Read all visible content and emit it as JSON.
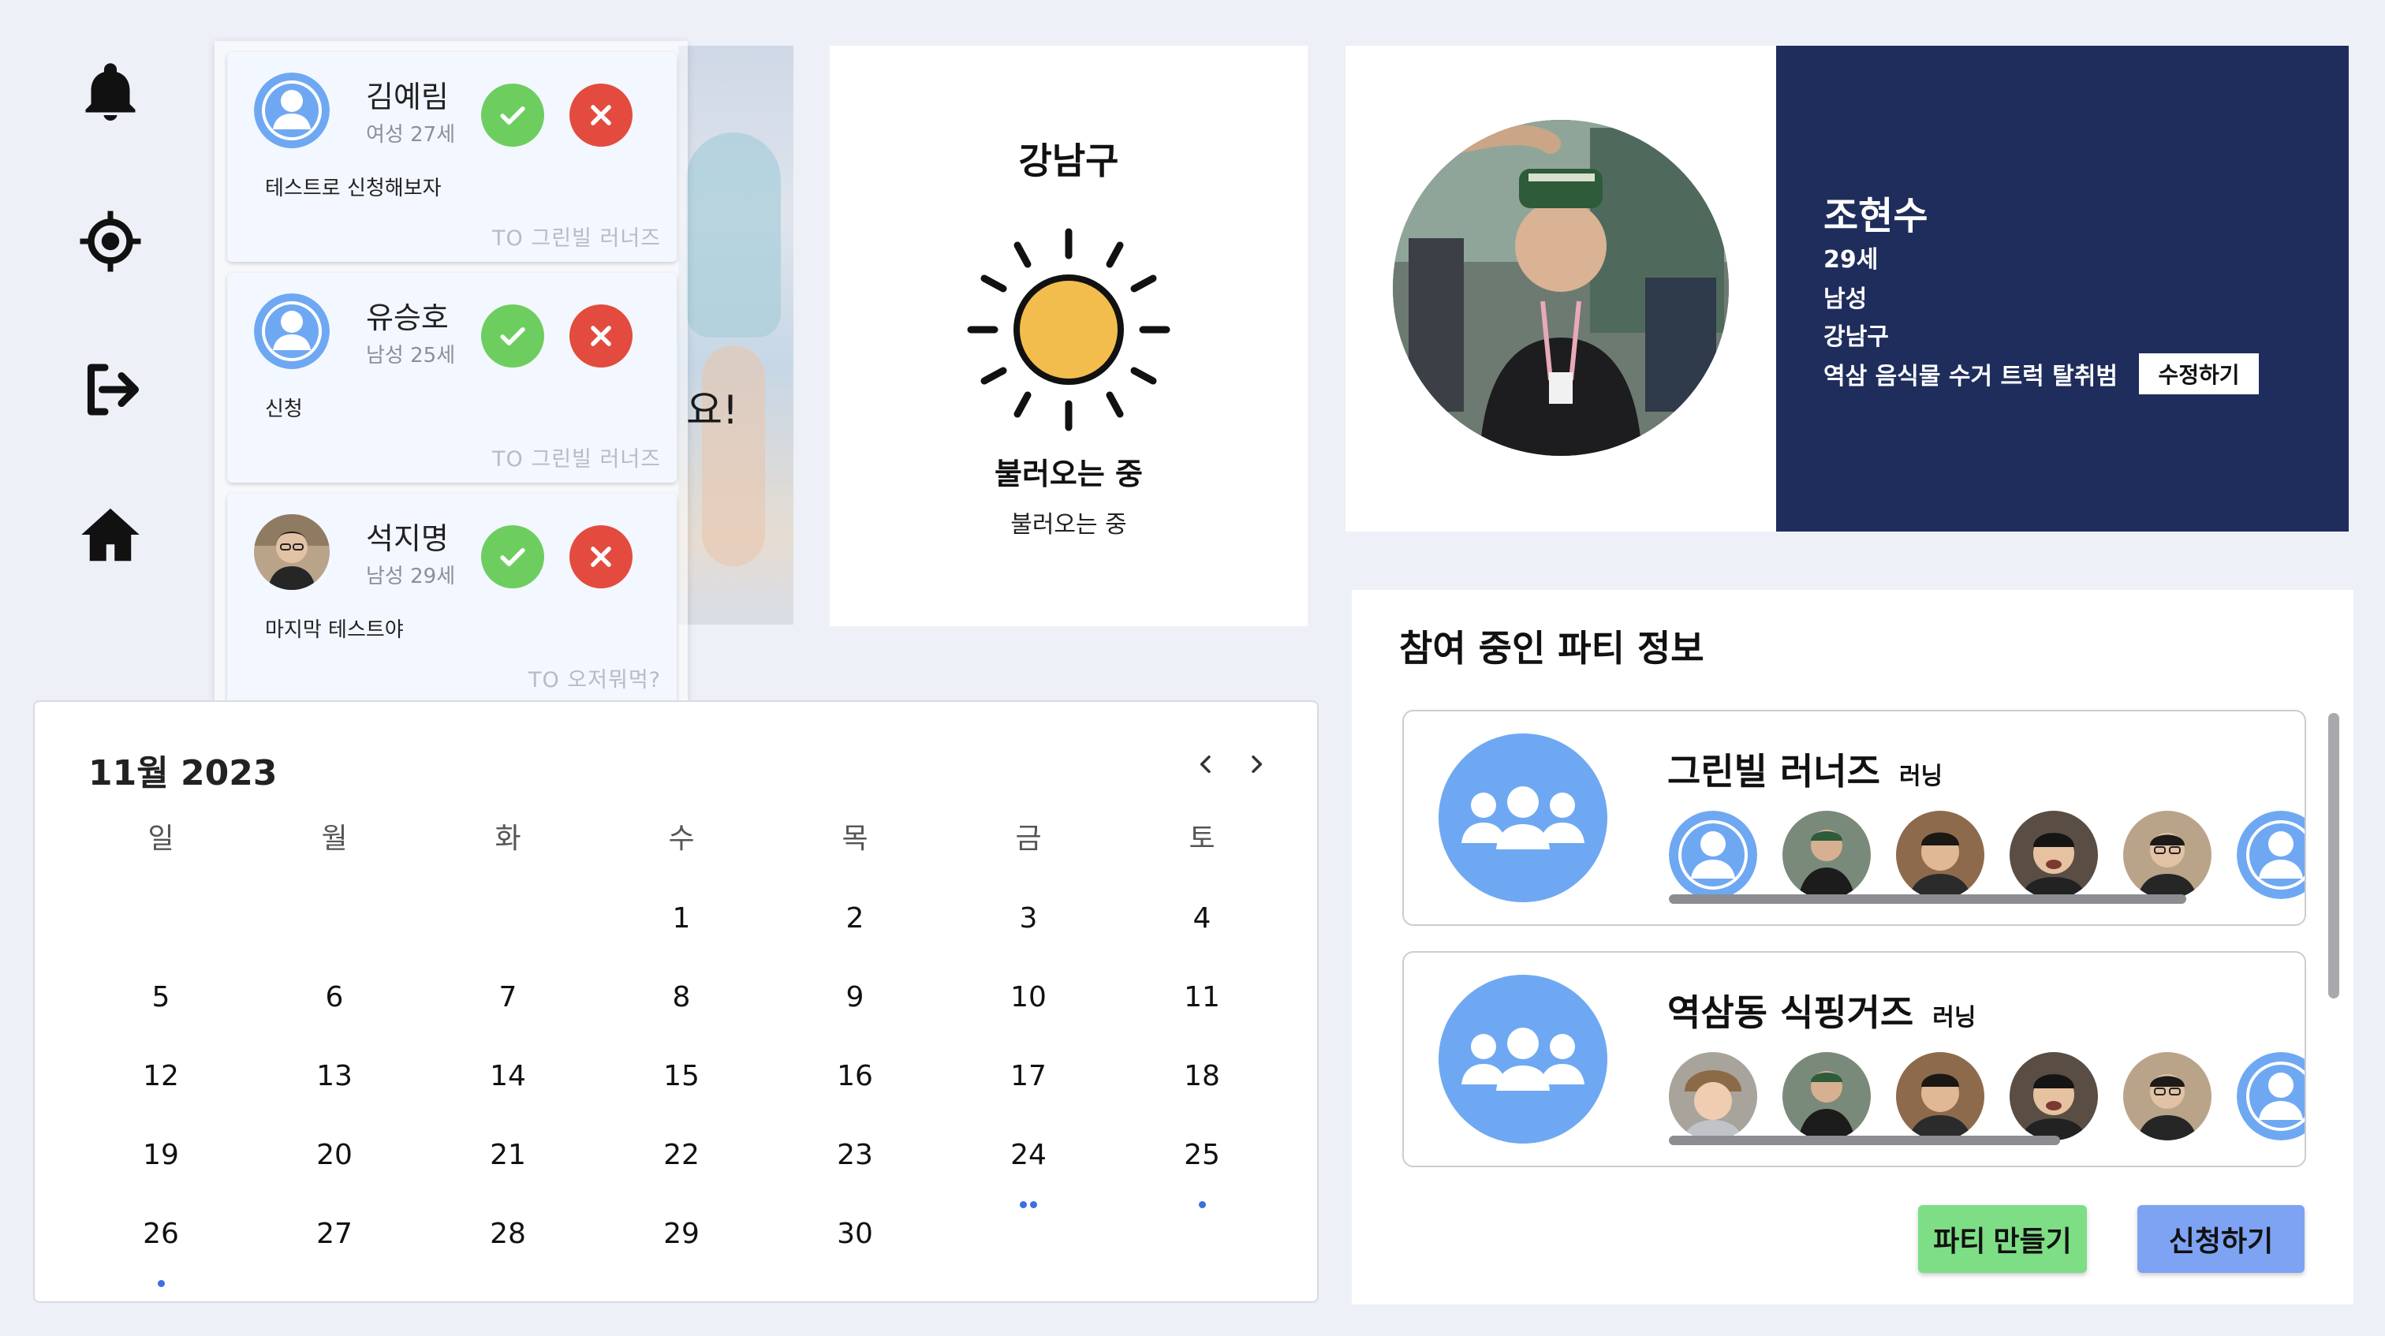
{
  "sidebar": {
    "items": [
      {
        "icon": "bell-icon"
      },
      {
        "icon": "target-icon"
      },
      {
        "icon": "logout-icon"
      },
      {
        "icon": "home-icon"
      }
    ]
  },
  "banner": {
    "text_fragment": "요!"
  },
  "notifications": [
    {
      "name": "김예림",
      "meta": "여성 27세",
      "message": "테스트로 신청해보자",
      "target": "TO 그린빌 러너즈",
      "avatar": "default"
    },
    {
      "name": "유승호",
      "meta": "남성 25세",
      "message": "신청",
      "target": "TO 그린빌 러너즈",
      "avatar": "default"
    },
    {
      "name": "석지명",
      "meta": "남성 29세",
      "message": "마지막 테스트야",
      "target": "TO 오저뭐먹?",
      "avatar": "photo"
    }
  ],
  "weather": {
    "region": "강남구",
    "status": "불러오는 중",
    "detail": "불러오는 중",
    "icon": "sun-icon",
    "sun_color": "#f2bd4c"
  },
  "profile": {
    "name": "조현수",
    "age": "29세",
    "gender": "남성",
    "district": "강남구",
    "bio": "역삼 음식물 수거 트럭 탈취범",
    "edit_label": "수정하기",
    "panel_color": "#1f2d5c"
  },
  "calendar": {
    "title": "11월 2023",
    "weekdays": [
      "일",
      "월",
      "화",
      "수",
      "목",
      "금",
      "토"
    ],
    "weeks": [
      [
        "",
        "",
        "",
        "1",
        "2",
        "3",
        "4"
      ],
      [
        "5",
        "6",
        "7",
        "8",
        "9",
        "10",
        "11"
      ],
      [
        "12",
        "13",
        "14",
        "15",
        "16",
        "17",
        "18"
      ],
      [
        "19",
        "20",
        "21",
        "22",
        "23",
        "24",
        "25"
      ],
      [
        "26",
        "27",
        "28",
        "29",
        "30",
        "",
        ""
      ]
    ],
    "event_dots": {
      "24": 2,
      "25": 1,
      "26": 1
    }
  },
  "parties": {
    "title": "참여 중인 파티 정보",
    "items": [
      {
        "name": "그린빌 러너즈",
        "tag": "러닝",
        "scroll_fraction": 0.82
      },
      {
        "name": "역삼동 식핑거즈",
        "tag": "러닝",
        "scroll_fraction": 0.62
      }
    ],
    "create_label": "파티 만들기",
    "apply_label": "신청하기",
    "create_color": "#7ede86",
    "apply_color": "#7ea3f3"
  }
}
